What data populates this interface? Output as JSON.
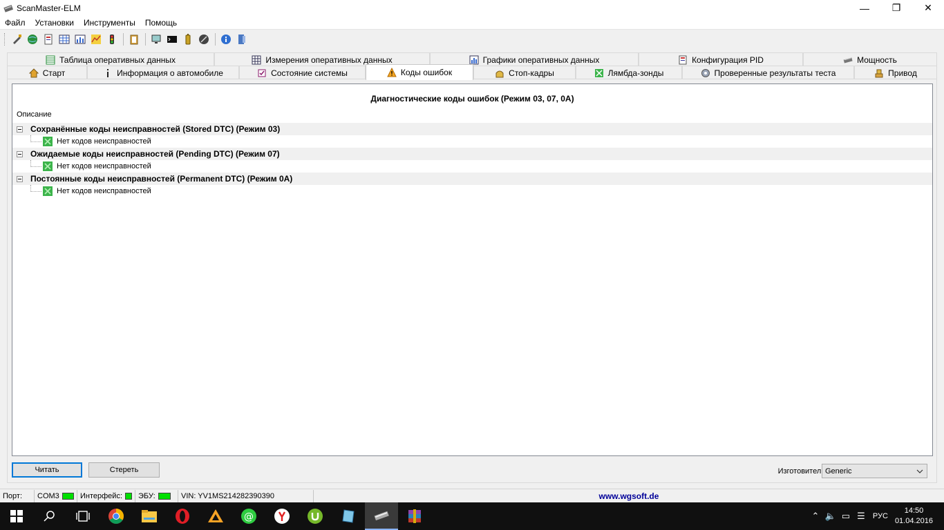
{
  "window": {
    "title": "ScanMaster-ELM",
    "controls": [
      "—",
      "❐",
      "✕"
    ]
  },
  "menu": [
    "Файл",
    "Установки",
    "Инструменты",
    "Помощь"
  ],
  "tabs": {
    "back": [
      {
        "label": "Таблица оперативных данных",
        "icon": "table-icon"
      },
      {
        "label": "Измерения оперативных данных",
        "icon": "grid-icon"
      },
      {
        "label": "Графики оперативных данных",
        "icon": "chart-icon"
      },
      {
        "label": "Конфигурация PID",
        "icon": "document-icon"
      },
      {
        "label": "Мощность",
        "icon": "engine-icon"
      }
    ],
    "front": [
      {
        "label": "Старт",
        "icon": "home-icon"
      },
      {
        "label": "Информация о автомобиле",
        "icon": "info-icon"
      },
      {
        "label": "Состояние системы",
        "icon": "checklist-icon"
      },
      {
        "label": "Коды ошибок",
        "icon": "warning-icon",
        "active": true
      },
      {
        "label": "Стоп-кадры",
        "icon": "snapshot-icon"
      },
      {
        "label": "Лямбда-зонды",
        "icon": "sensor-icon"
      },
      {
        "label": "Проверенные результаты теста",
        "icon": "gear-icon"
      },
      {
        "label": "Привод",
        "icon": "actuator-icon"
      }
    ]
  },
  "dtc": {
    "header": "Диагностические коды ошибок (Режим 03, 07, 0A)",
    "column": "Описание",
    "groups": [
      {
        "label": "Сохранённые коды неисправностей (Stored DTC) (Режим 03)",
        "child": "Нет кодов неисправностей"
      },
      {
        "label": "Ожидаемые коды неисправностей (Pending DTC) (Режим 07)",
        "child": "Нет кодов неисправностей"
      },
      {
        "label": "Постоянные коды неисправностей (Permanent DTC) (Режим 0A)",
        "child": "Нет кодов неисправностей"
      }
    ]
  },
  "buttons": {
    "read": "Читать",
    "clear": "Стереть"
  },
  "manufacturer": {
    "label": "Изготовитель",
    "value": "Generic"
  },
  "status": {
    "port_label": "Порт:",
    "port_value": "COM3",
    "interface_label": "Интерфейс:",
    "ecu_label": "ЭБУ:",
    "vin": "VIN: YV1MS214282390390",
    "link": "www.wgsoft.de"
  },
  "taskbar": {
    "lang": "РУС",
    "time": "14:50",
    "date": "01.04.2016"
  }
}
